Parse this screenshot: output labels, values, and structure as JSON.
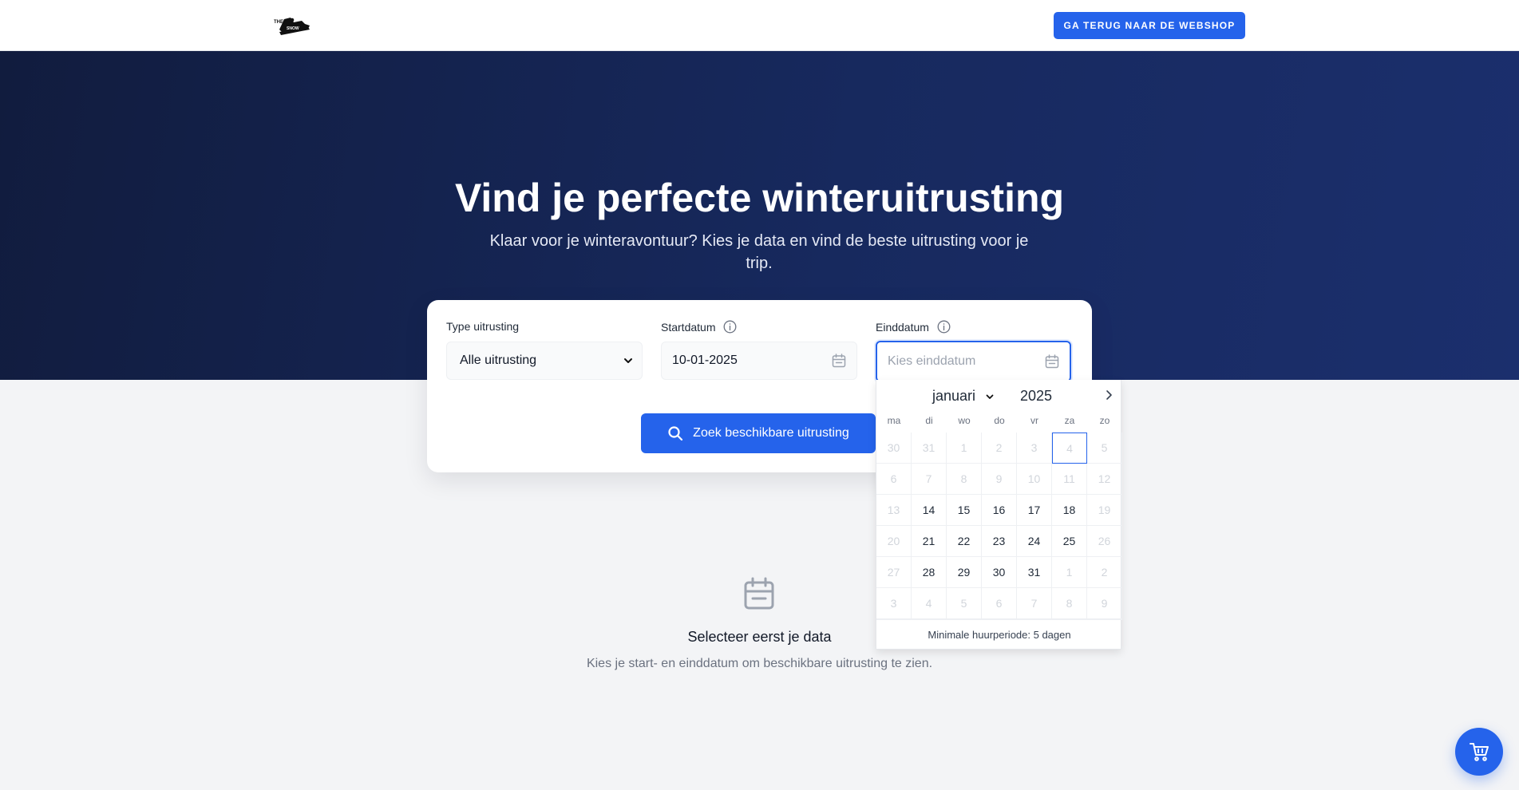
{
  "header": {
    "logo_icon": "snowboarder-logo",
    "back_button": "GA TERUG NAAR DE WEBSHOP"
  },
  "hero": {
    "title": "Vind je perfecte winteruitrusting",
    "subtitle": "Klaar voor je winteravontuur? Kies je data en vind de beste uitrusting voor je trip."
  },
  "search": {
    "type_label": "Type uitrusting",
    "type_value": "Alle uitrusting",
    "start_label": "Startdatum",
    "start_value": "10-01-2025",
    "end_label": "Einddatum",
    "end_placeholder": "Kies einddatum",
    "search_button": "Zoek beschikbare uitrusting"
  },
  "datepicker": {
    "month": "januari",
    "year": "2025",
    "weekdays": [
      "ma",
      "di",
      "wo",
      "do",
      "vr",
      "za",
      "zo"
    ],
    "weeks": [
      [
        {
          "d": "30",
          "dis": true
        },
        {
          "d": "31",
          "dis": true
        },
        {
          "d": "1",
          "dis": true
        },
        {
          "d": "2",
          "dis": true
        },
        {
          "d": "3",
          "dis": true
        },
        {
          "d": "4",
          "dis": true,
          "today": true
        },
        {
          "d": "5",
          "dis": true
        }
      ],
      [
        {
          "d": "6",
          "dis": true
        },
        {
          "d": "7",
          "dis": true
        },
        {
          "d": "8",
          "dis": true
        },
        {
          "d": "9",
          "dis": true
        },
        {
          "d": "10",
          "dis": true
        },
        {
          "d": "11",
          "dis": true
        },
        {
          "d": "12",
          "dis": true
        }
      ],
      [
        {
          "d": "13",
          "dis": true
        },
        {
          "d": "14"
        },
        {
          "d": "15"
        },
        {
          "d": "16"
        },
        {
          "d": "17"
        },
        {
          "d": "18"
        },
        {
          "d": "19",
          "dis": true
        }
      ],
      [
        {
          "d": "20",
          "dis": true
        },
        {
          "d": "21"
        },
        {
          "d": "22"
        },
        {
          "d": "23"
        },
        {
          "d": "24"
        },
        {
          "d": "25"
        },
        {
          "d": "26",
          "dis": true
        }
      ],
      [
        {
          "d": "27",
          "dis": true
        },
        {
          "d": "28"
        },
        {
          "d": "29"
        },
        {
          "d": "30"
        },
        {
          "d": "31"
        },
        {
          "d": "1",
          "dis": true
        },
        {
          "d": "2",
          "dis": true
        }
      ],
      [
        {
          "d": "3",
          "dis": true
        },
        {
          "d": "4",
          "dis": true
        },
        {
          "d": "5",
          "dis": true
        },
        {
          "d": "6",
          "dis": true
        },
        {
          "d": "7",
          "dis": true
        },
        {
          "d": "8",
          "dis": true
        },
        {
          "d": "9",
          "dis": true
        }
      ]
    ],
    "footer": "Minimale huurperiode: 5 dagen"
  },
  "empty_state": {
    "icon": "calendar-icon",
    "title": "Selecteer eerst je data",
    "text": "Kies je start- en einddatum om beschikbare uitrusting te zien."
  },
  "cart": {
    "icon": "cart-icon"
  },
  "colors": {
    "accent": "#2563eb",
    "hero_dark": "#111c3e",
    "hero_light": "#1b2f6d"
  }
}
